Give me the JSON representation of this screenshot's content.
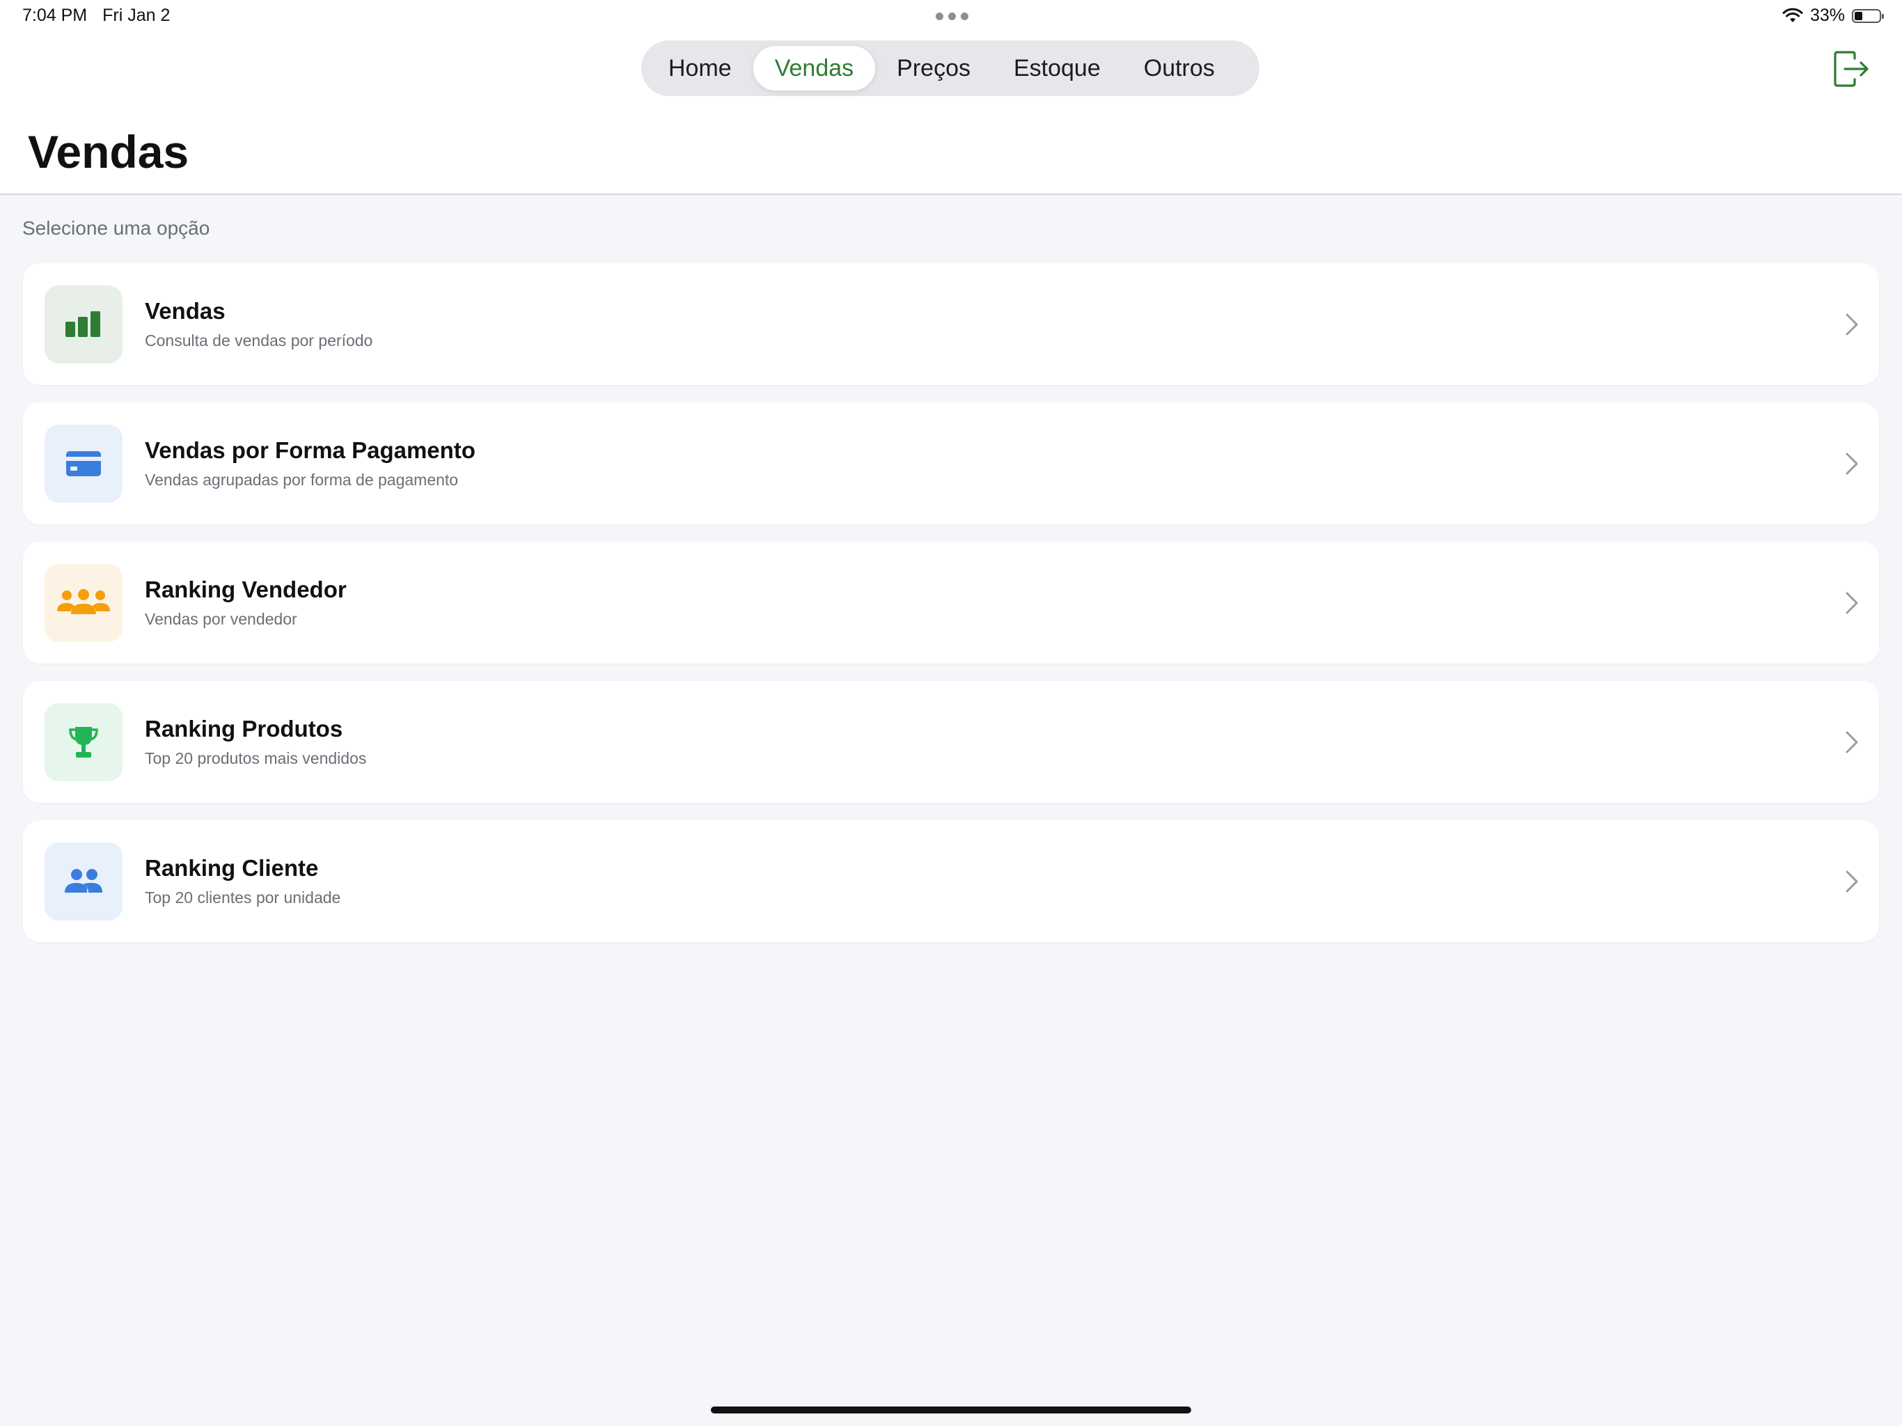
{
  "status_bar": {
    "time": "7:04 PM",
    "date": "Fri Jan 2",
    "battery": "33%",
    "battery_level": 0.33
  },
  "tabs": [
    {
      "label": "Home",
      "active": false
    },
    {
      "label": "Vendas",
      "active": true
    },
    {
      "label": "Preços",
      "active": false
    },
    {
      "label": "Estoque",
      "active": false
    },
    {
      "label": "Outros",
      "active": false
    }
  ],
  "header": {
    "title": "Vendas",
    "logout_icon": "logout-icon"
  },
  "section_caption": "Selecione uma opção",
  "items": [
    {
      "title": "Vendas",
      "subtitle": "Consulta de vendas por período",
      "icon": "bar-chart-icon",
      "icon_color": "#2e7d32",
      "icon_bg": "#e8efe8"
    },
    {
      "title": "Vendas por Forma Pagamento",
      "subtitle": "Vendas agrupadas por forma de pagamento",
      "icon": "credit-card-icon",
      "icon_color": "#3b7ddd",
      "icon_bg": "#e8f0fc"
    },
    {
      "title": "Ranking Vendedor",
      "subtitle": "Vendas por vendedor",
      "icon": "group-icon",
      "icon_color": "#f59e0b",
      "icon_bg": "#fdf3e4"
    },
    {
      "title": "Ranking Produtos",
      "subtitle": "Top 20 produtos mais vendidos",
      "icon": "trophy-icon",
      "icon_color": "#22b455",
      "icon_bg": "#e6f6ec"
    },
    {
      "title": "Ranking Cliente",
      "subtitle": "Top 20 clientes por unidade",
      "icon": "people-icon",
      "icon_color": "#3b7ddd",
      "icon_bg": "#e8f0fc"
    }
  ]
}
